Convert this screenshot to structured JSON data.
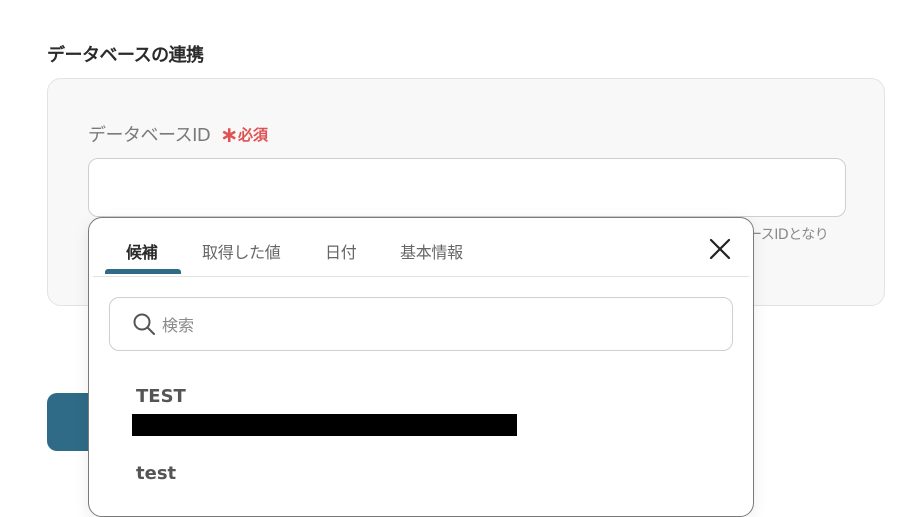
{
  "section": {
    "title": "データベースの連携"
  },
  "field": {
    "label": "データベースID",
    "required_star": "∗",
    "required_text": "必須",
    "value": "",
    "help_text": "ースIDとなり"
  },
  "dropdown": {
    "tabs": [
      {
        "label": "候補"
      },
      {
        "label": "取得した値"
      },
      {
        "label": "日付"
      },
      {
        "label": "基本情報"
      }
    ],
    "search": {
      "placeholder": "検索"
    },
    "items": [
      {
        "name": "TEST"
      },
      {
        "name": "test"
      }
    ]
  },
  "colors": {
    "accent": "#2f6b87",
    "required": "#e05252"
  },
  "icons": {
    "close": "close-icon",
    "search": "search-icon"
  }
}
